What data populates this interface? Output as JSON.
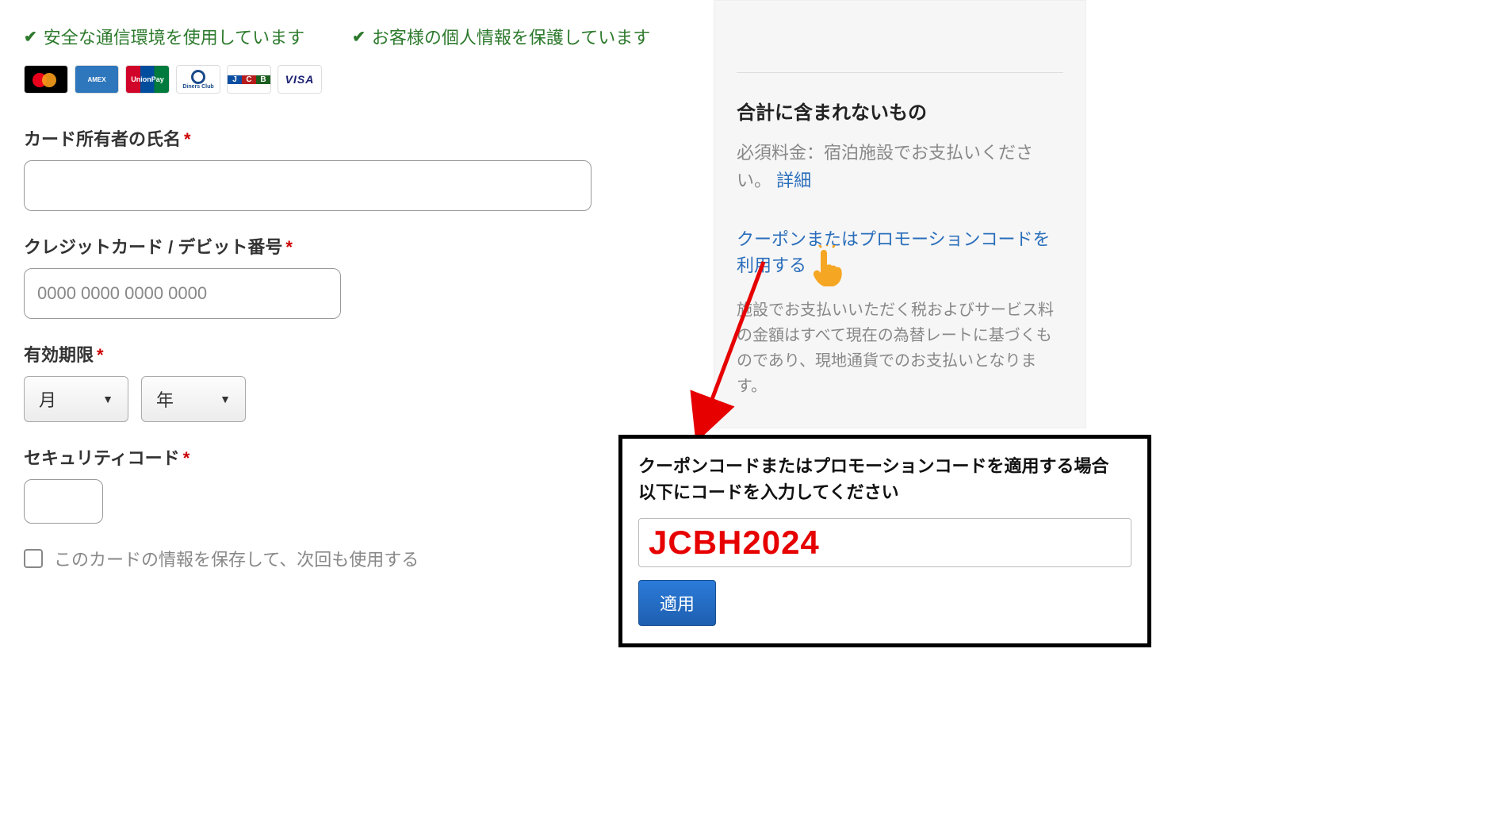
{
  "security": {
    "secure_comm": "安全な通信環境を使用しています",
    "privacy": "お客様の個人情報を保護しています"
  },
  "card_brands": [
    "mastercard",
    "amex",
    "unionpay",
    "diners",
    "jcb",
    "visa"
  ],
  "form": {
    "cardholder": {
      "label": "カード所有者の氏名"
    },
    "cardnumber": {
      "label": "クレジットカード / デビット番号",
      "placeholder": "0000 0000 0000 0000"
    },
    "expiry": {
      "label": "有効期限",
      "month": "月",
      "year": "年"
    },
    "cvv": {
      "label": "セキュリティコード"
    },
    "save_card": "このカードの情報を保存して、次回も使用する"
  },
  "sidebar": {
    "excluded_title": "合計に含まれないもの",
    "required_fee": "必須料金：宿泊施設でお支払いください。",
    "details": "詳細",
    "coupon_link": "クーポンまたはプロモーションコードを利用する",
    "disclaimer": "施設でお支払いいただく税およびサービス料の金額はすべて現在の為替レートに基づくものであり、現地通貨でのお支払いとなります。"
  },
  "coupon_box": {
    "heading_line1": "クーポンコードまたはプロモーションコードを適用する場合",
    "heading_line2": "以下にコードを入力してください",
    "code": "JCBH2024",
    "apply": "適用"
  }
}
